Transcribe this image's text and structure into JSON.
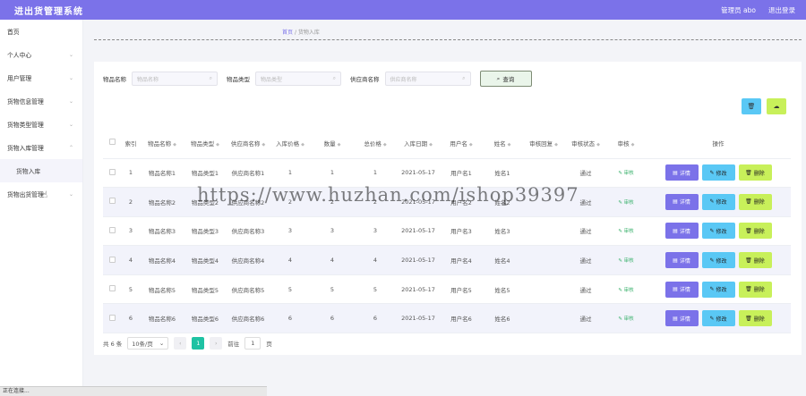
{
  "app": {
    "title": "进出货管理系统",
    "user": "管理员 abo",
    "logout": "退出登录"
  },
  "sidebar": {
    "items": [
      {
        "label": "首页",
        "chevron": ""
      },
      {
        "label": "个人中心",
        "chevron": "⌄"
      },
      {
        "label": "用户管理",
        "chevron": "⌄"
      },
      {
        "label": "货物信息管理",
        "chevron": "⌄"
      },
      {
        "label": "货物类型管理",
        "chevron": "⌄"
      },
      {
        "label": "货物入库管理",
        "chevron": "⌃"
      },
      {
        "label": "货物入库",
        "chevron": ""
      },
      {
        "label": "货物出货管理",
        "chevron": "⌄"
      }
    ]
  },
  "breadcrumb": {
    "home": "首页",
    "sep": "/",
    "current": "货物入库"
  },
  "search": {
    "fields": [
      {
        "label": "物品名称",
        "placeholder": "物品名称"
      },
      {
        "label": "物品类型",
        "placeholder": "物品类型"
      },
      {
        "label": "供应商名称",
        "placeholder": "供应商名称"
      }
    ],
    "query_label": "查询"
  },
  "table": {
    "headers": [
      "索引",
      "物品名称",
      "物品类型",
      "供应商名称",
      "入库价格",
      "数量",
      "总价格",
      "入库日期",
      "用户名",
      "姓名",
      "审核回复",
      "审核状态",
      "审核",
      "操作"
    ],
    "audit_label": "审核",
    "ops": {
      "detail": "详情",
      "edit": "修改",
      "remove": "删除"
    },
    "rows": [
      {
        "idx": "1",
        "name": "物品名称1",
        "type": "物品类型1",
        "supplier": "供应商名称1",
        "price": "1",
        "qty": "1",
        "total": "1",
        "date": "2021-05-17",
        "user": "用户名1",
        "realname": "姓名1",
        "reply": "",
        "status": "通过"
      },
      {
        "idx": "2",
        "name": "物品名称2",
        "type": "物品类型2",
        "supplier": "供应商名称2",
        "price": "2",
        "qty": "2",
        "total": "2",
        "date": "2021-05-17",
        "user": "用户名2",
        "realname": "姓名2",
        "reply": "",
        "status": "通过"
      },
      {
        "idx": "3",
        "name": "物品名称3",
        "type": "物品类型3",
        "supplier": "供应商名称3",
        "price": "3",
        "qty": "3",
        "total": "3",
        "date": "2021-05-17",
        "user": "用户名3",
        "realname": "姓名3",
        "reply": "",
        "status": "通过"
      },
      {
        "idx": "4",
        "name": "物品名称4",
        "type": "物品类型4",
        "supplier": "供应商名称4",
        "price": "4",
        "qty": "4",
        "total": "4",
        "date": "2021-05-17",
        "user": "用户名4",
        "realname": "姓名4",
        "reply": "",
        "status": "通过"
      },
      {
        "idx": "5",
        "name": "物品名称5",
        "type": "物品类型5",
        "supplier": "供应商名称5",
        "price": "5",
        "qty": "5",
        "total": "5",
        "date": "2021-05-17",
        "user": "用户名5",
        "realname": "姓名5",
        "reply": "",
        "status": "通过"
      },
      {
        "idx": "6",
        "name": "物品名称6",
        "type": "物品类型6",
        "supplier": "供应商名称6",
        "price": "6",
        "qty": "6",
        "total": "6",
        "date": "2021-05-17",
        "user": "用户名6",
        "realname": "姓名6",
        "reply": "",
        "status": "通过"
      }
    ]
  },
  "pagination": {
    "total": "共 6 条",
    "page_size": "10条/页",
    "current": "1",
    "goto_label": "前往",
    "goto_value": "1",
    "page_unit": "页"
  },
  "status_bar": "正在连接...",
  "watermark": "https://www.huzhan.com/ishop39397",
  "icons": {
    "search": "search-icon",
    "delete": "trash-icon",
    "upload": "upload-icon"
  },
  "colors": {
    "primary": "#7b72e9",
    "edit": "#5ac8f5",
    "remove": "#c8f05a",
    "page_active": "#1ec2a3"
  }
}
